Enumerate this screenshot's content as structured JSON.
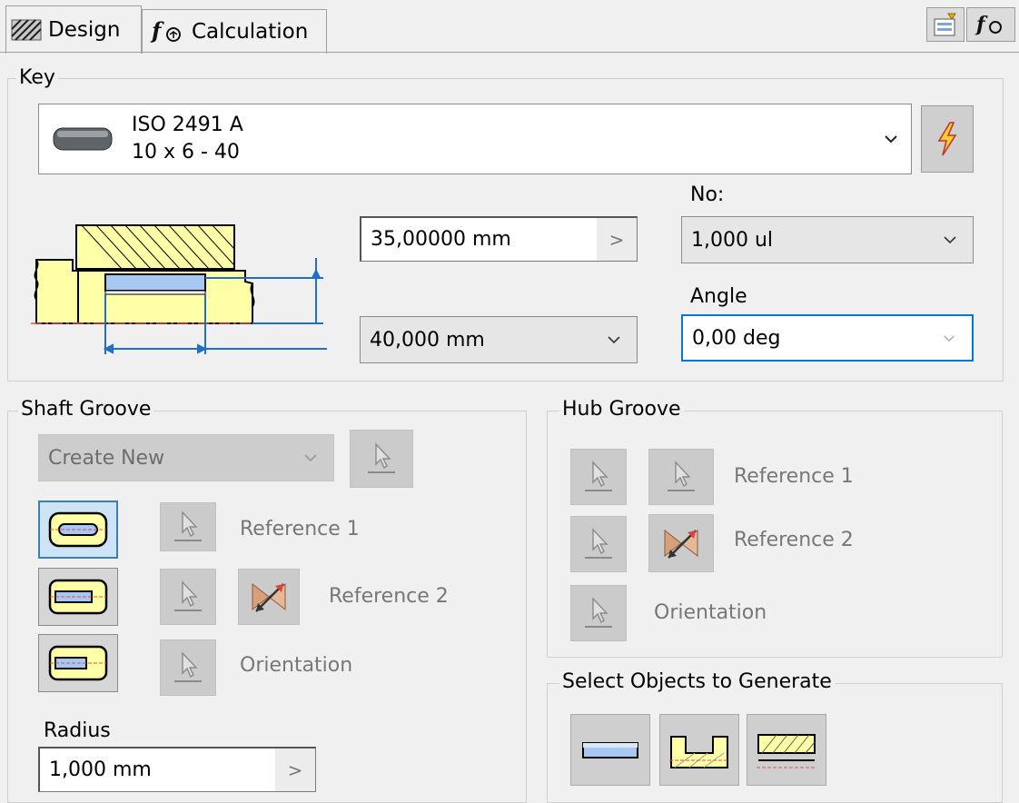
{
  "tabs": [
    {
      "label": "Design",
      "icon": "hatch-icon"
    },
    {
      "label": "Calculation",
      "icon": "function-icon"
    }
  ],
  "toolbar": {
    "icons": [
      "settings-icon",
      "function-icon"
    ]
  },
  "key": {
    "group_label": "Key",
    "standard": "ISO 2491 A",
    "size": "10 x 6 - 40",
    "diameter_value": "35,00000 mm",
    "length_value": "40,000 mm",
    "no_label": "No:",
    "no_value": "1,000 ul",
    "angle_label": "Angle",
    "angle_value": "0,00 deg"
  },
  "shaft_groove": {
    "group_label": "Shaft Groove",
    "create_new": "Create New",
    "reference1": "Reference 1",
    "reference2": "Reference 2",
    "orientation": "Orientation",
    "radius_label": "Radius",
    "radius_value": "1,000 mm"
  },
  "hub_groove": {
    "group_label": "Hub Groove",
    "reference1": "Reference 1",
    "reference2": "Reference 2",
    "orientation": "Orientation"
  },
  "generate": {
    "group_label": "Select Objects to Generate"
  },
  "colors": {
    "accent": "#0078d7",
    "part_fill": "#ffffa8",
    "key_fill": "#a7c8f0",
    "dim_line": "#1f6fc8"
  }
}
